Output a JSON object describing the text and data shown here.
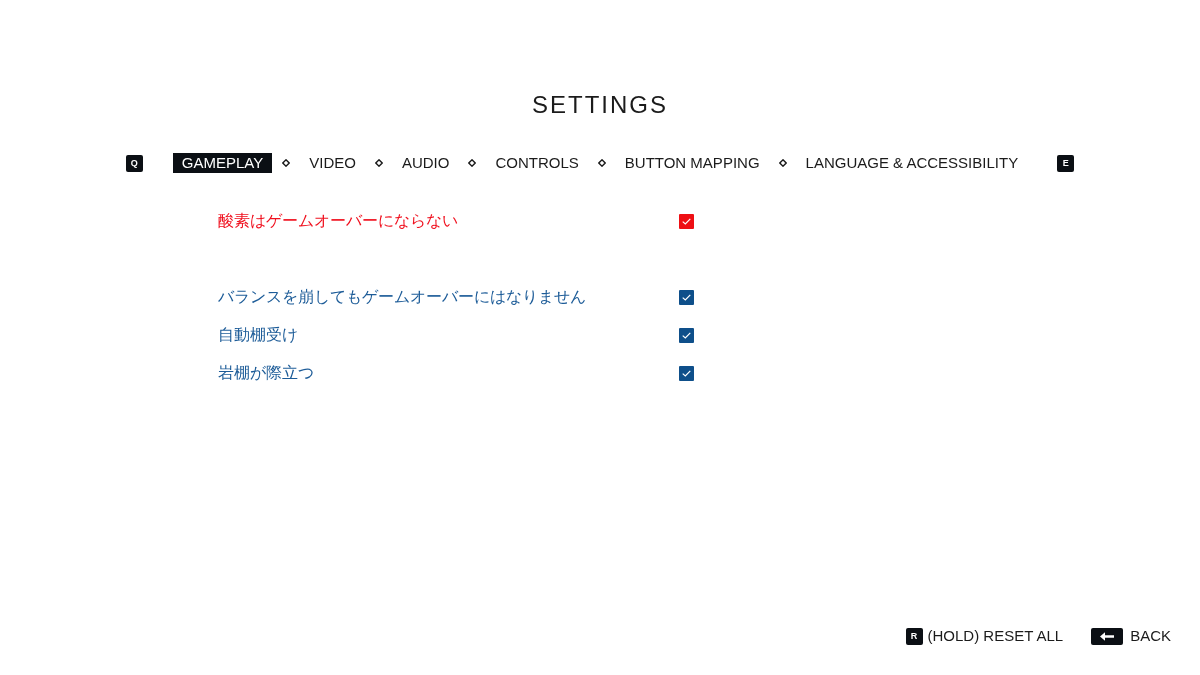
{
  "title": "SETTINGS",
  "tab_bar": {
    "prev_key": "Q",
    "next_key": "E",
    "tabs": [
      {
        "label": "GAMEPLAY",
        "selected": true
      },
      {
        "label": "VIDEO",
        "selected": false
      },
      {
        "label": "AUDIO",
        "selected": false
      },
      {
        "label": "CONTROLS",
        "selected": false
      },
      {
        "label": "BUTTON MAPPING",
        "selected": false
      },
      {
        "label": "LANGUAGE & ACCESSIBILITY",
        "selected": false
      }
    ]
  },
  "sections": [
    {
      "options": [
        {
          "label": "酸素はゲームオーバーにならない",
          "selected": true,
          "checked": true
        }
      ]
    },
    {
      "options": [
        {
          "label": "バランスを崩してもゲームオーバーにはなりません",
          "selected": false,
          "checked": true
        },
        {
          "label": "自動棚受け",
          "selected": false,
          "checked": true
        },
        {
          "label": "岩棚が際立つ",
          "selected": false,
          "checked": true
        }
      ]
    }
  ],
  "footer": {
    "actions": [
      {
        "kind": "key",
        "key": "R",
        "label": "(HOLD) RESET ALL"
      },
      {
        "kind": "back",
        "label": "BACK"
      }
    ]
  }
}
